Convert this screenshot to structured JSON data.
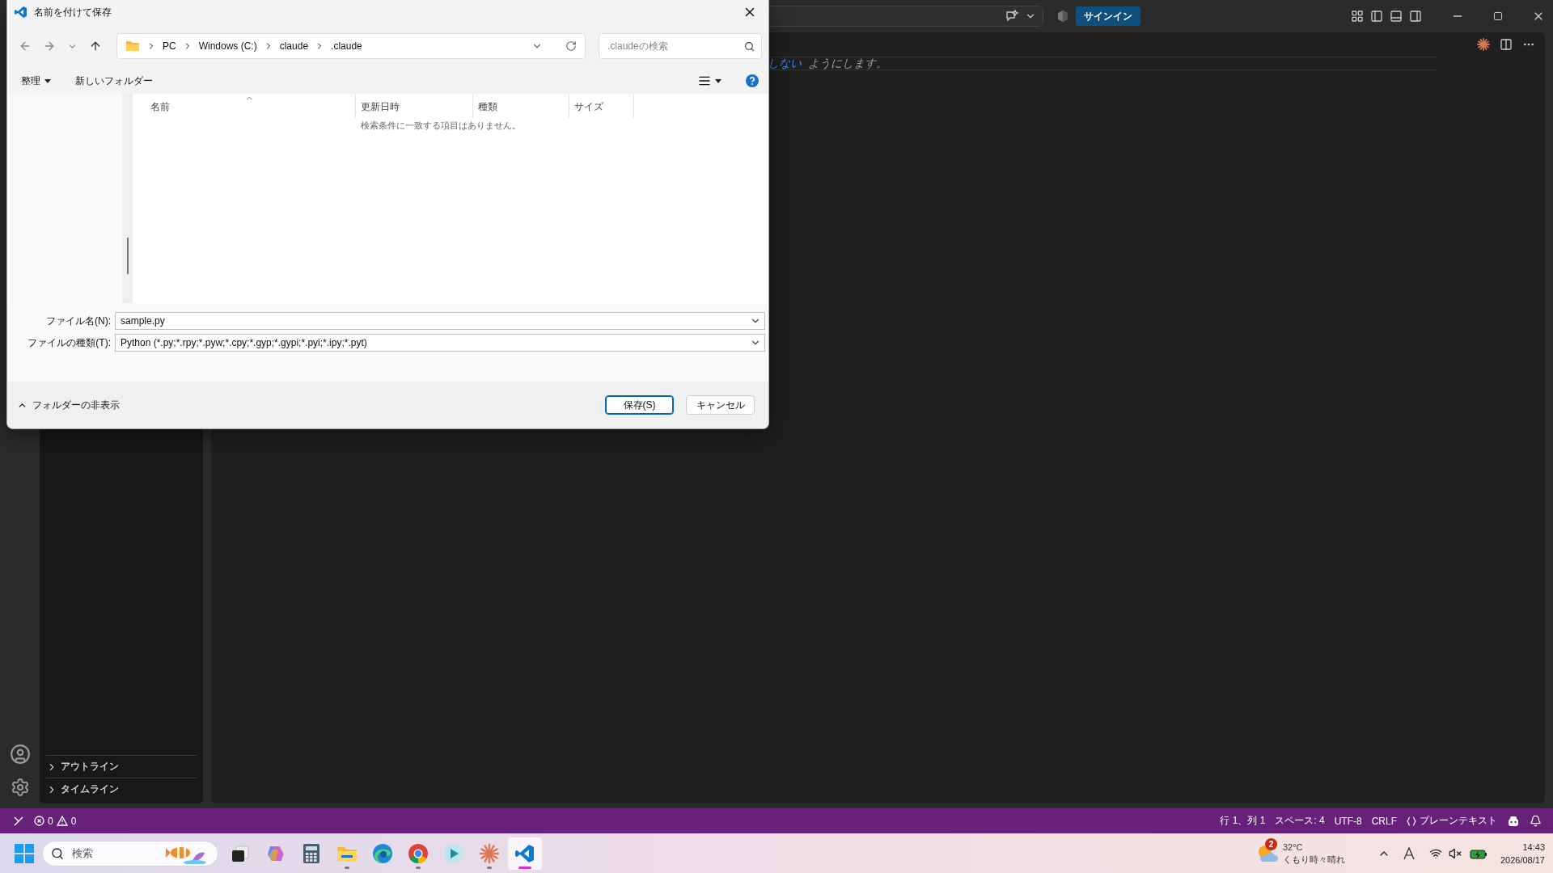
{
  "vscode": {
    "title_bar": {
      "sign_in": "サインイン"
    },
    "editor": {
      "fragments": [
        {
          "text": "しない",
          "kind": "keyword"
        },
        {
          "text": "ようにします。",
          "kind": "plain"
        }
      ]
    },
    "sidebar": {
      "sections": [
        {
          "label": "アウトライン",
          "expanded": false
        },
        {
          "label": "タイムライン",
          "expanded": false
        }
      ]
    },
    "status_bar": {
      "errors": "0",
      "warnings": "0",
      "items": [
        {
          "text": "行 1、列 1",
          "kind": "text"
        },
        {
          "text": "スペース: 4",
          "kind": "text"
        },
        {
          "text": "UTF-8",
          "kind": "text"
        },
        {
          "text": "CRLF",
          "kind": "text"
        },
        {
          "text": "プレーンテキスト",
          "kind": "language"
        }
      ]
    }
  },
  "dialog": {
    "title": "名前を付けて保存",
    "breadcrumbs": [
      "PC",
      "Windows (C:)",
      "claude",
      ".claude"
    ],
    "search": {
      "placeholder": ".claudeの検索"
    },
    "toolbar": [
      {
        "label": "整理",
        "kind": "menu"
      },
      {
        "label": "新しいフォルダー",
        "kind": "plain"
      }
    ],
    "columns": [
      {
        "label": "名前",
        "sorted": true
      },
      {
        "label": "更新日時",
        "sorted": false
      },
      {
        "label": "種類",
        "sorted": false
      },
      {
        "label": "サイズ",
        "sorted": false
      }
    ],
    "empty_message": "検索条件に一致する項目はありません。",
    "fields": [
      {
        "label": "ファイル名(N):",
        "value": "sample.py"
      },
      {
        "label": "ファイルの種類(T):",
        "value": "Python (*.py;*.rpy;*.pyw;*.cpy;*.gyp;*.gypi;*.pyi;*.ipy;*.pyt)"
      }
    ],
    "hide_folders": "フォルダーの非表示",
    "buttons": [
      {
        "label": "保存(S)",
        "default": true
      },
      {
        "label": "キャンセル",
        "default": false
      }
    ]
  },
  "taskbar": {
    "search": {
      "placeholder": "検索"
    },
    "apps": [
      {
        "kind": "taskview",
        "running": false,
        "active": false
      },
      {
        "kind": "copilot",
        "running": false,
        "active": false
      },
      {
        "kind": "calculator",
        "running": false,
        "active": false
      },
      {
        "kind": "explorer",
        "running": true,
        "active": false
      },
      {
        "kind": "edge",
        "running": false,
        "active": false
      },
      {
        "kind": "chrome",
        "running": true,
        "active": false
      },
      {
        "kind": "teal",
        "running": false,
        "active": false
      },
      {
        "kind": "claude",
        "running": true,
        "active": false
      },
      {
        "kind": "vscode",
        "running": true,
        "active": true
      }
    ],
    "weather": {
      "badge": "2",
      "temperature": "32°C",
      "condition": "くもり時々晴れ"
    },
    "clock": {
      "time": "14:43",
      "date": "2026/08/17"
    }
  }
}
